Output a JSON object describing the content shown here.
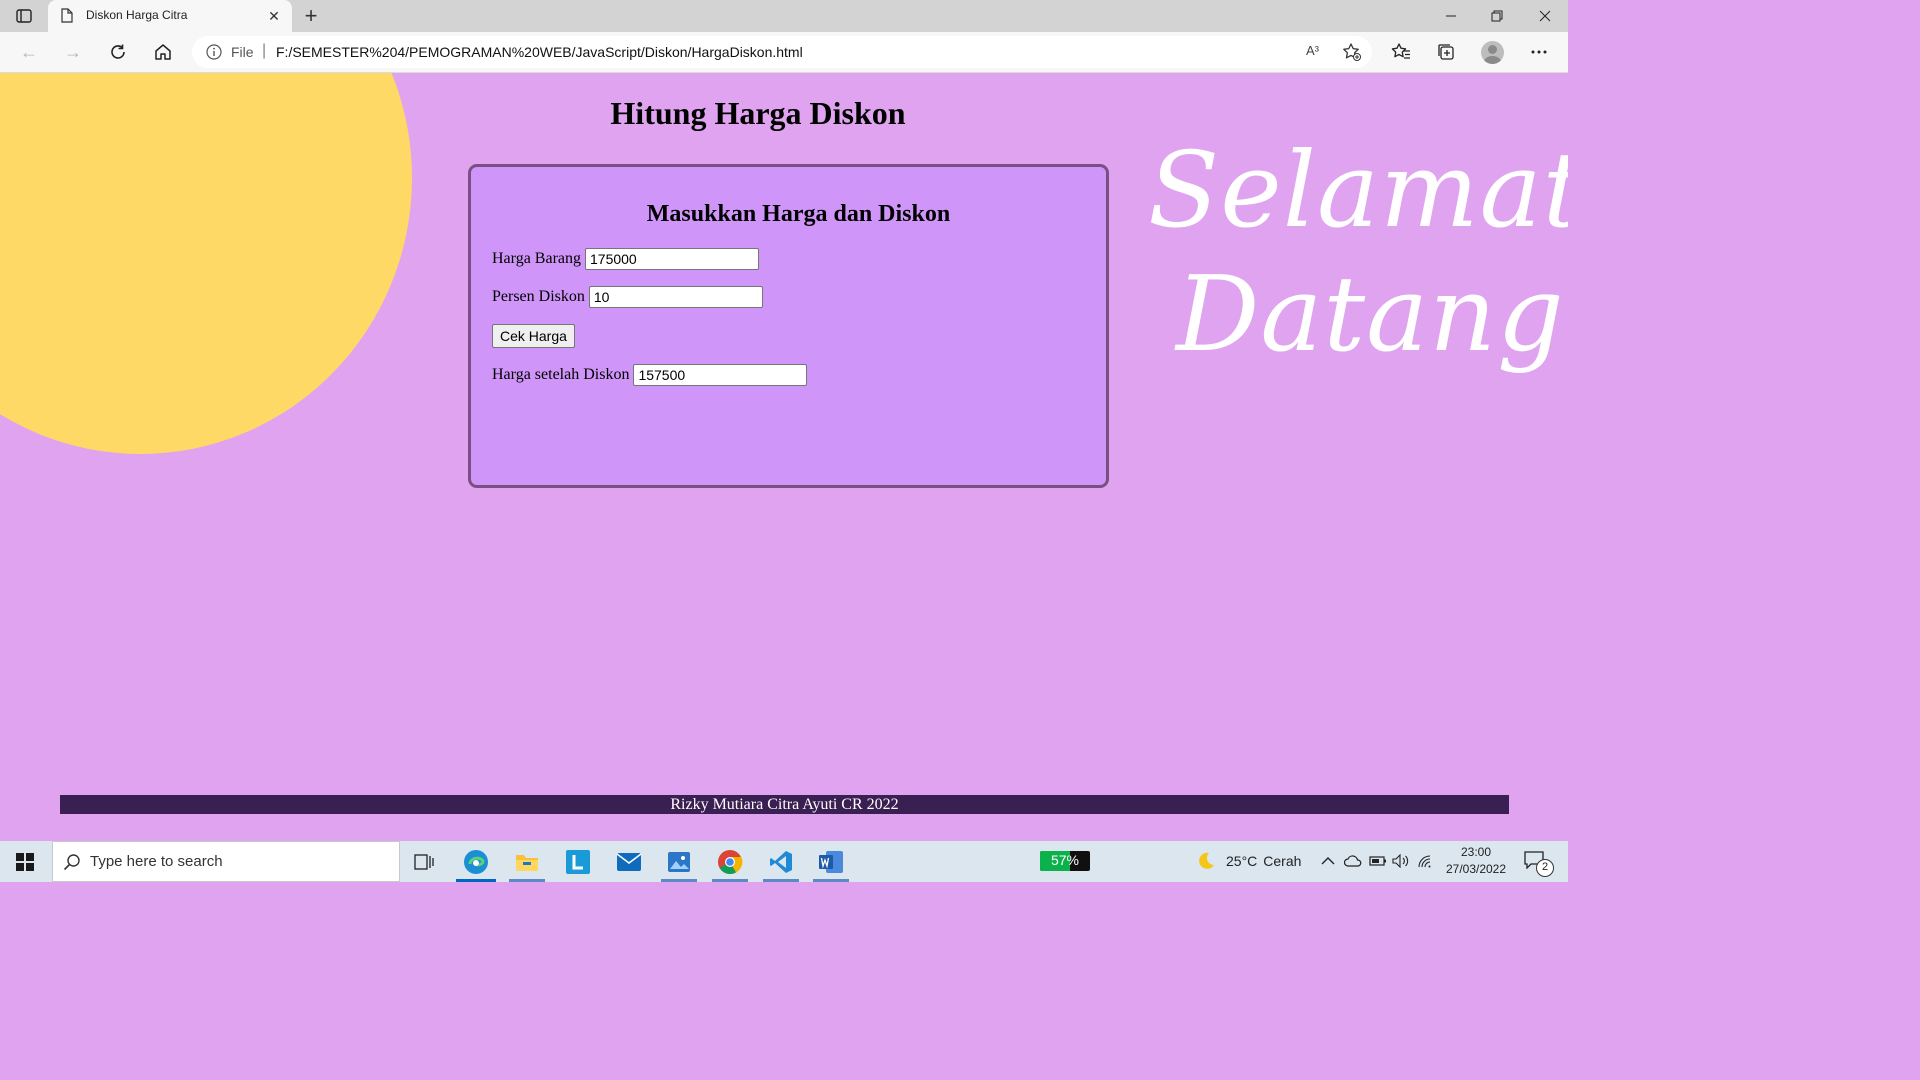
{
  "browser": {
    "tab": {
      "title": "Diskon Harga Citra"
    },
    "new_tab_label": "+",
    "address": {
      "scheme": "File",
      "url": "F:/SEMESTER%204/PEMOGRAMAN%20WEB/JavaScript/Diskon/HargaDiskon.html",
      "read_aloud": "A³"
    }
  },
  "page": {
    "title": "Hitung Harga Diskon",
    "form": {
      "heading": "Masukkan Harga dan Diskon",
      "harga_label": "Harga Barang",
      "harga_value": "175000",
      "diskon_label": "Persen Diskon",
      "diskon_value": "10",
      "button_label": "Cek Harga",
      "result_label": "Harga setelah Diskon",
      "result_value": "157500"
    },
    "welcome": {
      "line1": "Selamat",
      "line2": "Datang"
    },
    "footer": "Rizky Mutiara Citra Ayuti CR 2022"
  },
  "taskbar": {
    "search_placeholder": "Type here to search",
    "battery_label": "57%",
    "weather": {
      "temp": "25°C",
      "condition": "Cerah"
    },
    "clock": {
      "time": "23:00",
      "date": "27/03/2022"
    },
    "notification_count": "2"
  },
  "colors": {
    "page_background": "#dfa3ef",
    "card_background": "#cf95f9",
    "card_border": "#7a4f84",
    "sun": "#ffd966",
    "footer_background": "#3a1f52"
  }
}
